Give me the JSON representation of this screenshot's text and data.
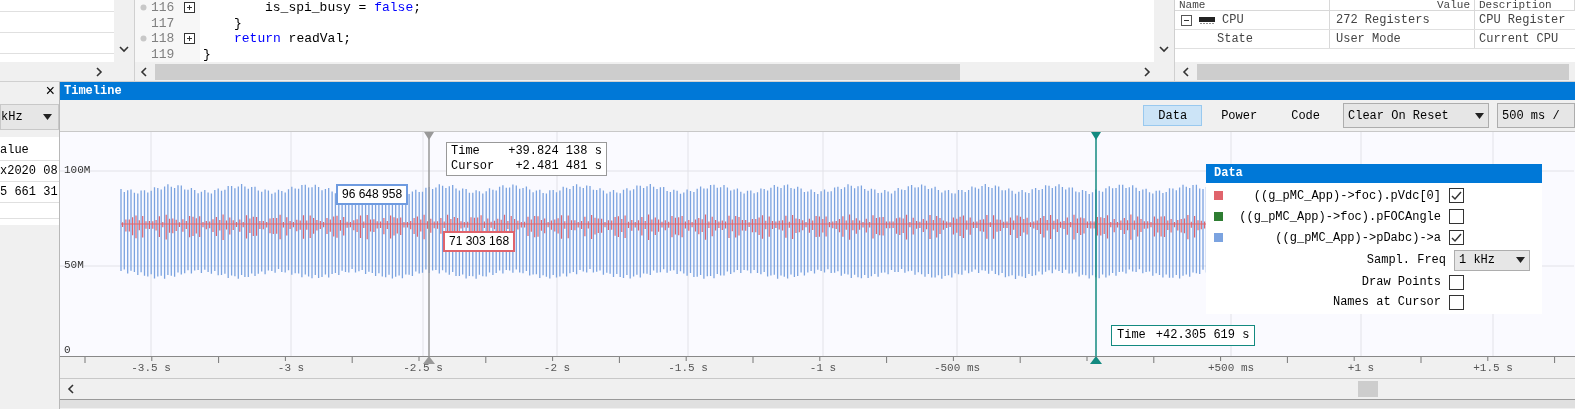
{
  "code_editor": {
    "lines": [
      {
        "number": "116",
        "foldable": true,
        "kind": "inner",
        "tokens": [
          {
            "text": "is_spi_busy = ",
            "kind": "plain"
          },
          {
            "text": "false",
            "kind": "keyword"
          },
          {
            "text": ";",
            "kind": "plain"
          }
        ]
      },
      {
        "number": "117",
        "foldable": false,
        "kind": "body",
        "tokens": [
          {
            "text": "}",
            "kind": "plain"
          }
        ]
      },
      {
        "number": "118",
        "foldable": true,
        "kind": "body",
        "tokens": [
          {
            "text": "return",
            "kind": "keyword"
          },
          {
            "text": " readVal;",
            "kind": "plain"
          }
        ]
      },
      {
        "number": "119",
        "foldable": false,
        "kind": "outer",
        "tokens": [
          {
            "text": "}",
            "kind": "plain"
          }
        ]
      }
    ]
  },
  "registers": {
    "columns": [
      "Name",
      "Value",
      "Description"
    ],
    "rows": [
      {
        "name": "CPU",
        "value": "272 Registers",
        "description": "CPU Register",
        "expanded": true
      },
      {
        "name": "State",
        "value": "User Mode",
        "description": "Current CPU"
      }
    ]
  },
  "side_panel": {
    "close": "×",
    "dropdown": "kHz",
    "rows": [
      "alue",
      "x2020 08",
      "5 661 31"
    ]
  },
  "timeline": {
    "title": "Timeline",
    "tabs": [
      {
        "label": "Data",
        "selected": true
      },
      {
        "label": "Power",
        "selected": false
      },
      {
        "label": "Code",
        "selected": false
      }
    ],
    "reset_dropdown": "Clear On Reset",
    "zoom_dropdown": "500 ms /",
    "y_labels": [
      "100M",
      "50M",
      "0"
    ],
    "x_labels": [
      "-3.5 s",
      "-3 s",
      "-2.5 s",
      "-2 s",
      "-1.5 s",
      "-1 s",
      "-500 ms",
      "+500 ms",
      "+1 s",
      "+1.5 s"
    ],
    "cursor": {
      "time_label": "Time",
      "time": "+39.824 138 s",
      "cursor_label": "Cursor",
      "offset": "+2.481 481 s",
      "values": [
        {
          "text": "96 648 958",
          "color": "#6f9be0"
        },
        {
          "text": "71 303 168",
          "color": "#e0646c"
        }
      ]
    },
    "marker": {
      "label": "Time",
      "time": "+42.305 619 s"
    },
    "legend": {
      "title": "Data",
      "signals": [
        {
          "name": "((g_pMC_App)->foc).pVdc[0]",
          "color": "#e0646c",
          "checked": true
        },
        {
          "name": "((g_pMC_App)->foc).pFOCAngle",
          "color": "#2e7d32",
          "checked": false
        },
        {
          "name": "((g_pMC_App)->pDabc)->a",
          "color": "#7ba3e0",
          "checked": true
        }
      ],
      "sampling": {
        "label": "Sampl. Freq",
        "value": "1 kHz"
      },
      "options": [
        {
          "label": "Draw Points",
          "checked": false
        },
        {
          "label": "Names at Cursor",
          "checked": false
        }
      ]
    }
  }
}
